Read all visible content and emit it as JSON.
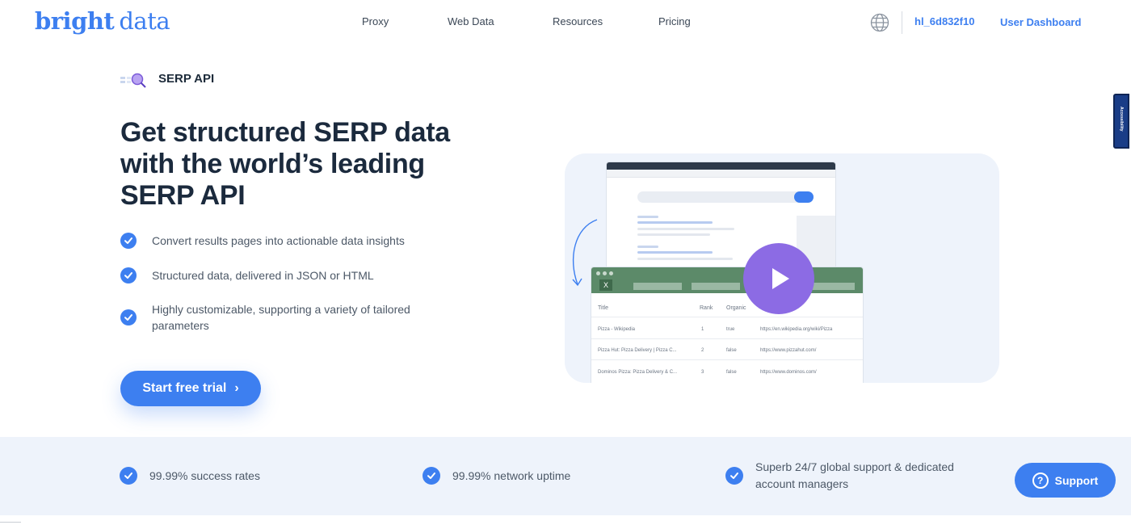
{
  "header": {
    "logo_bold": "bright",
    "logo_light": "data",
    "nav": [
      "Proxy",
      "Web Data",
      "Resources",
      "Pricing"
    ],
    "globe_icon": "globe-icon",
    "user_id": "hl_6d832f10",
    "dashboard_label": "User Dashboard"
  },
  "product": {
    "label": "SERP API",
    "icon": "serp-magnifier-icon"
  },
  "hero": {
    "title": "Get structured SERP data with the world’s leading SERP API",
    "features": [
      "Convert results pages into actionable data insights",
      "Structured data, delivered in JSON or HTML",
      "Highly customizable, supporting a variety of tailored parameters"
    ],
    "cta_label": "Start free trial",
    "cta_chevron": "›"
  },
  "illustration": {
    "close_label": "X",
    "columns": [
      "Title",
      "Rank",
      "Organic"
    ],
    "rows": [
      {
        "title": "Pizza - Wikipedia",
        "rank": "1",
        "organic": "true",
        "url": "https://en.wikipedia.org/wiki/Pizza"
      },
      {
        "title": "Pizza Hut: Pizza Delivery | Pizza C...",
        "rank": "2",
        "organic": "false",
        "url": "https://www.pizzahut.com/"
      },
      {
        "title": "Dominos Pizza: Pizza Delivery & C...",
        "rank": "3",
        "organic": "false",
        "url": "https://www.dominos.com/"
      }
    ],
    "play_icon": "play-icon"
  },
  "a11y_tab": "Accessibility",
  "benefits": [
    "99.99% success rates",
    "99.99% network uptime",
    "Superb 24/7 global support & dedicated account managers"
  ],
  "support": {
    "label": "Support",
    "icon_glyph": "?"
  },
  "colors": {
    "brand": "#3d7ff0",
    "heading": "#1b2a3d",
    "band": "#eef3fb",
    "play": "#8c6be4",
    "table_bar": "#5c8a69"
  }
}
